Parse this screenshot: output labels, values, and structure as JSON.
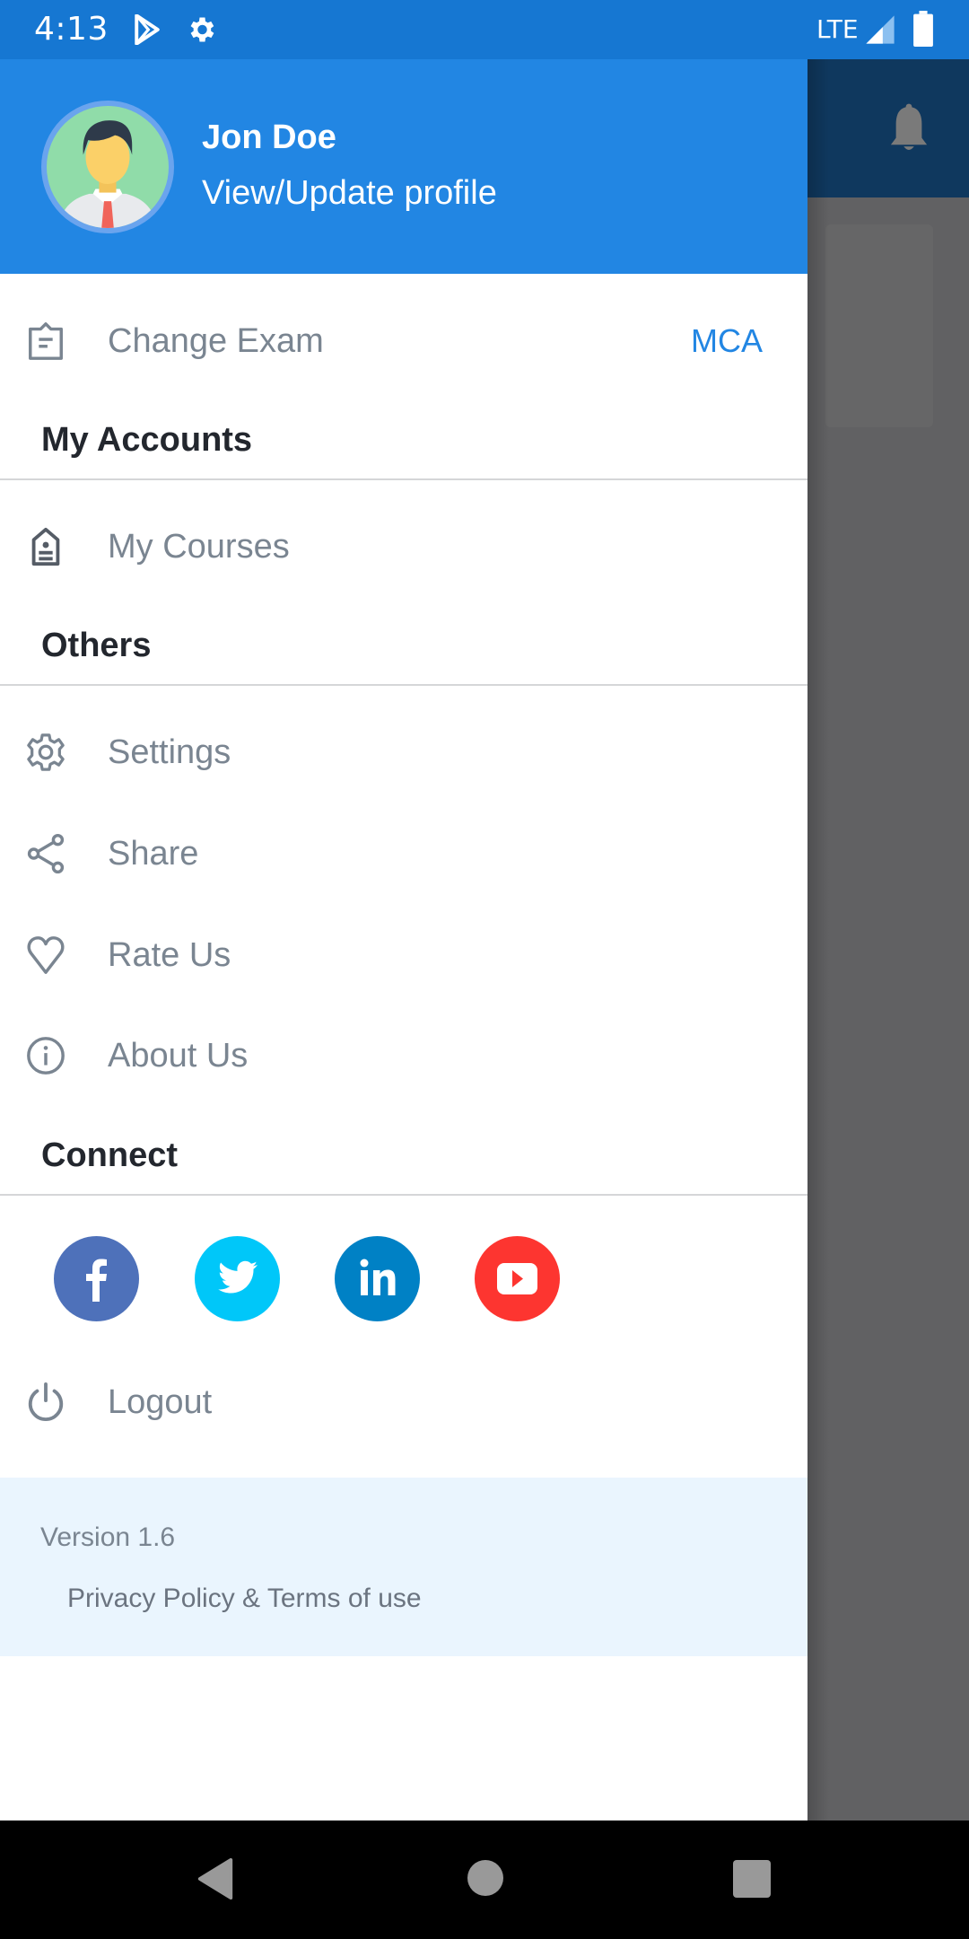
{
  "status_bar": {
    "time": "4:13",
    "notification_icons": [
      "play-store-icon",
      "settings-gear-icon"
    ],
    "network": "LTE",
    "signal_icon": "signal-icon",
    "battery_icon": "battery-icon"
  },
  "background_app": {
    "icons": [
      "bell-icon"
    ]
  },
  "drawer": {
    "header": {
      "user_name": "Jon Doe",
      "profile_link": "View/Update profile",
      "avatar": "avatar-icon"
    },
    "change_exam": {
      "label": "Change Exam",
      "value": "MCA",
      "icon": "clipboard-icon"
    },
    "sections": [
      {
        "title": "My Accounts",
        "items": [
          {
            "label": "My Courses",
            "icon": "id-badge-icon"
          }
        ]
      },
      {
        "title": "Others",
        "items": [
          {
            "label": "Settings",
            "icon": "gear-icon"
          },
          {
            "label": "Share",
            "icon": "share-icon"
          },
          {
            "label": "Rate Us",
            "icon": "heart-icon"
          },
          {
            "label": "About Us",
            "icon": "info-icon"
          }
        ]
      },
      {
        "title": "Connect",
        "social": [
          {
            "name": "Facebook",
            "icon": "facebook-icon",
            "color": "#4e71ba"
          },
          {
            "name": "Twitter",
            "icon": "twitter-icon",
            "color": "#00c7f9"
          },
          {
            "name": "LinkedIn",
            "icon": "linkedin-icon",
            "color": "#0081c5"
          },
          {
            "name": "YouTube",
            "icon": "youtube-icon",
            "color": "#fd3530"
          }
        ]
      }
    ],
    "logout": {
      "label": "Logout",
      "icon": "power-icon"
    },
    "footer": {
      "version": "Version 1.6",
      "privacy": "Privacy Policy & Terms of use"
    }
  },
  "colors": {
    "status_bar": "#1677d2",
    "header": "#2286e3",
    "accent": "#2286e3",
    "item_text": "#7a8591",
    "section_text": "#23272e",
    "footer_bg": "#eaf5fe"
  },
  "nav_bar": {
    "buttons": [
      "back-icon",
      "home-icon",
      "recents-icon"
    ]
  }
}
